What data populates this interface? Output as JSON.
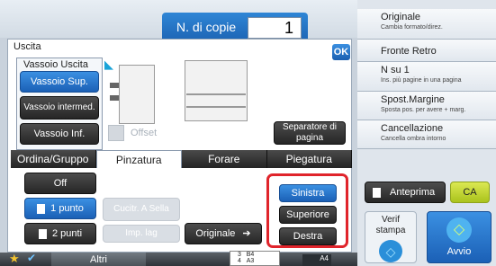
{
  "header": {
    "copies_label": "N. di copie",
    "copies_value": "1"
  },
  "panel": {
    "title": "Uscita",
    "ok_label": "OK"
  },
  "vassoio": {
    "title": "Vassoio Uscita",
    "items": [
      {
        "label": "Vassoio Sup."
      },
      {
        "label": "Vassoio intermed."
      },
      {
        "label": "Vassoio Inf."
      }
    ]
  },
  "offset_label": "Offset",
  "separatore_label": "Separatore di pagina",
  "tabs": [
    {
      "label": "Ordina/Gruppo"
    },
    {
      "label": "Pinzatura"
    },
    {
      "label": "Forare"
    },
    {
      "label": "Piegatura"
    }
  ],
  "pinzatura": {
    "off_label": "Off",
    "punto1_label": "1 punto",
    "punti2_label": "2 punti",
    "sella_label": "Cucitr. A Sella",
    "imp_label": "Imp. lag",
    "originale_label": "Originale"
  },
  "position": {
    "sinistra": "Sinistra",
    "superiore": "Superiore",
    "destra": "Destra"
  },
  "sidebar": {
    "items": [
      {
        "title": "Originale",
        "sub": "Cambia formato/direz."
      },
      {
        "title": "Fronte Retro",
        "sub": ""
      },
      {
        "title": "N su 1",
        "sub": "Ins. più pagine in una pagina"
      },
      {
        "title": "Spost.Margine",
        "sub": "Sposta pos. per avere + marg."
      },
      {
        "title": "Cancellazione",
        "sub": "Cancella ombra intorno"
      }
    ]
  },
  "actions": {
    "anteprima": "Anteprima",
    "ca": "CA",
    "verif": "Verif stampa",
    "avvio": "Avvio"
  },
  "bottom": {
    "altri": "Altri",
    "paper_a4": "A4",
    "tray3": "3",
    "tray3_size": "B4",
    "tray4": "4",
    "tray4_size": "A3"
  },
  "colors": {
    "accent_blue": "#1f6fc5",
    "ok_green": "#b7d526",
    "highlight_red": "#e0242b"
  }
}
